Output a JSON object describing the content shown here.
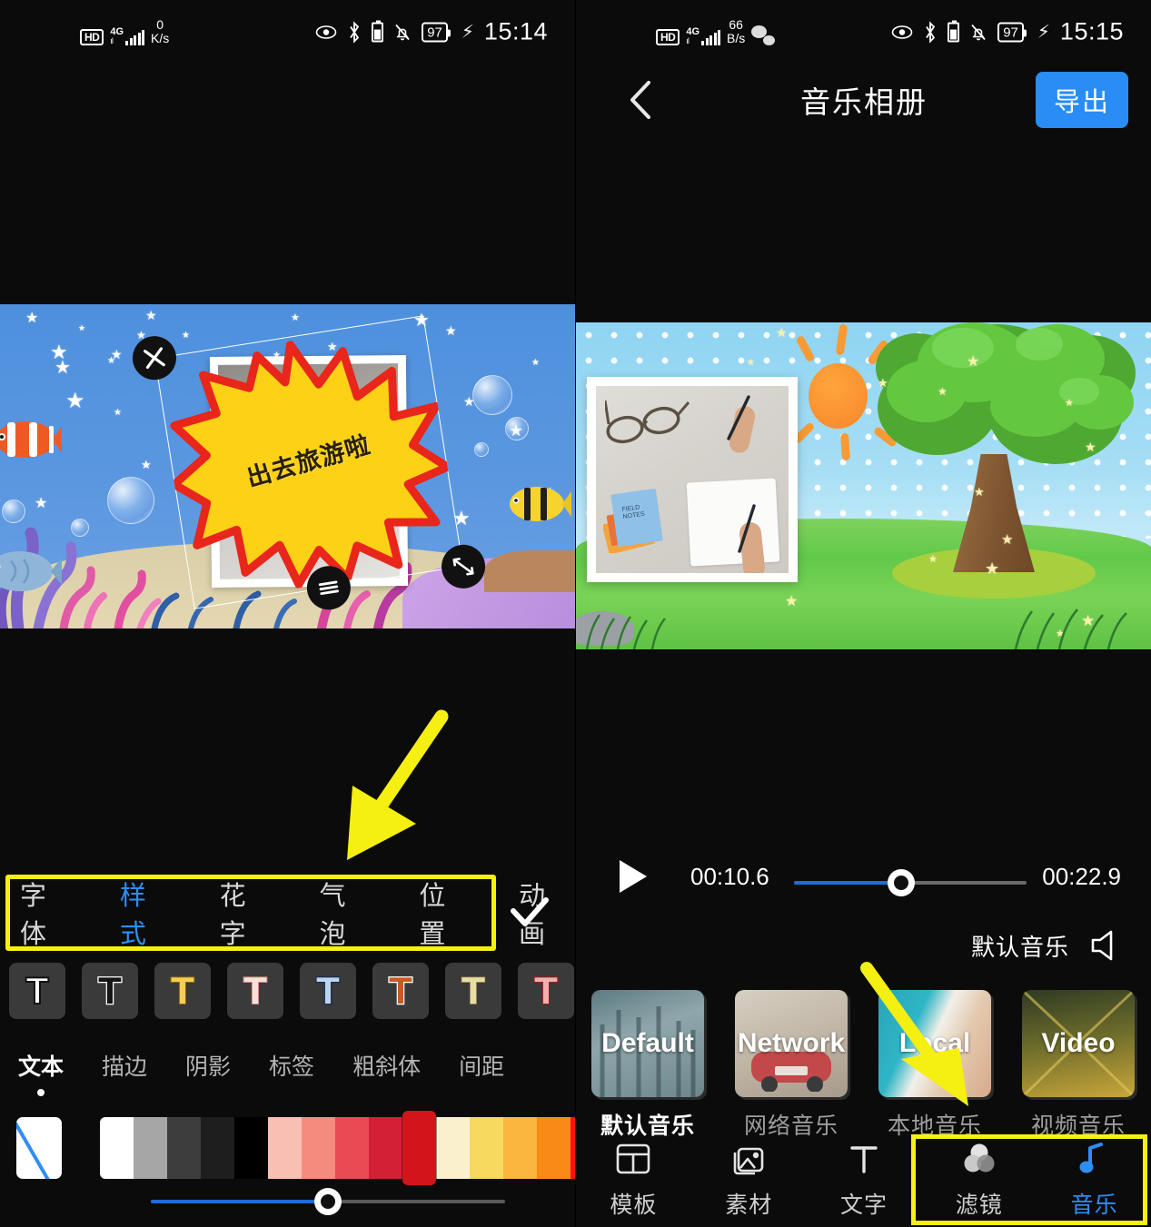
{
  "left_screen": {
    "statusbar": {
      "hd": "HD",
      "network": "4G",
      "netspeed_value": "0",
      "netspeed_unit": "K/s",
      "battery_percent": "97",
      "time": "15:14",
      "icons": [
        "eye-icon",
        "bluetooth-icon",
        "bell-muted-icon",
        "battery-icon",
        "charging-bolt-icon"
      ]
    },
    "preview": {
      "sticker_text": "出去旅游啦",
      "handles": [
        "close-handle",
        "resize-handle",
        "menu-handle"
      ]
    },
    "tabs": [
      {
        "label": "字体",
        "active": false
      },
      {
        "label": "样式",
        "active": true
      },
      {
        "label": "花字",
        "active": false
      },
      {
        "label": "气泡",
        "active": false
      },
      {
        "label": "位置",
        "active": false
      },
      {
        "label": "动画",
        "active": false
      }
    ],
    "confirm_icon": "check-icon",
    "presets": [
      {
        "name": "preset-white-plain",
        "fill": "#ffffff",
        "stroke": "#101010"
      },
      {
        "name": "preset-black-white-outline",
        "fill": "#141414",
        "stroke": "#ffffff"
      },
      {
        "name": "preset-yellow",
        "fill": "#f4cf56",
        "stroke": "#8a6a14"
      },
      {
        "name": "preset-pink-glow",
        "fill": "#f0ded9",
        "stroke": "#d98b79"
      },
      {
        "name": "preset-blue",
        "fill": "#bcd6f2",
        "stroke": "#1b2c4a"
      },
      {
        "name": "preset-orange-outline",
        "fill": "#c85a22",
        "stroke": "#ffffff"
      },
      {
        "name": "preset-cream",
        "fill": "#e8dda6",
        "stroke": "#b09f5e"
      },
      {
        "name": "preset-salmon-red",
        "fill": "#eeb1ac",
        "stroke": "#8d1f20"
      }
    ],
    "subtabs": [
      {
        "label": "文本",
        "active": true
      },
      {
        "label": "描边",
        "active": false
      },
      {
        "label": "阴影",
        "active": false
      },
      {
        "label": "标签",
        "active": false
      },
      {
        "label": "粗斜体",
        "active": false
      },
      {
        "label": "间距",
        "active": false
      }
    ],
    "colors": {
      "none_swatch": "none-color-swatch",
      "palette": [
        {
          "hex": "#ffffff",
          "selected": false
        },
        {
          "hex": "#a6a6a6",
          "selected": false
        },
        {
          "hex": "#3d3d3d",
          "selected": false
        },
        {
          "hex": "#1e1e1e",
          "selected": false
        },
        {
          "hex": "#000000",
          "selected": false
        },
        {
          "hex": "#f9bfb2",
          "selected": false
        },
        {
          "hex": "#f58a7f",
          "selected": false
        },
        {
          "hex": "#ea4a52",
          "selected": false
        },
        {
          "hex": "#d32036",
          "selected": false
        },
        {
          "hex": "#d2151b",
          "selected": true
        },
        {
          "hex": "#fbf0cd",
          "selected": false
        },
        {
          "hex": "#f6d95e",
          "selected": false
        },
        {
          "hex": "#fab63f",
          "selected": false
        },
        {
          "hex": "#fa8a16",
          "selected": false
        },
        {
          "hex": "#f81414",
          "selected": false
        }
      ],
      "opacity_percent": 50
    },
    "annotation": {
      "arrow": "yellow-arrow-down-left",
      "highlight": "yellow-box-tabs"
    }
  },
  "right_screen": {
    "statusbar": {
      "hd": "HD",
      "network": "4G",
      "netspeed_value": "66",
      "netspeed_unit": "B/s",
      "battery_percent": "97",
      "time": "15:15",
      "icons": [
        "wechat-icon",
        "eye-icon",
        "bluetooth-icon",
        "bell-muted-icon",
        "battery-icon",
        "charging-bolt-icon"
      ]
    },
    "header": {
      "back_icon": "back-chevron-icon",
      "title": "音乐相册",
      "export_label": "导出"
    },
    "player": {
      "play_icon": "play-icon",
      "current_time": "00:10.6",
      "total_time": "00:22.9",
      "progress_percent": 46
    },
    "music_label": {
      "text": "默认音乐",
      "icon": "speaker-icon"
    },
    "music_cards": [
      {
        "thumb_label": "Default",
        "caption": "默认音乐",
        "active": true
      },
      {
        "thumb_label": "Network",
        "caption": "网络音乐",
        "active": false
      },
      {
        "thumb_label": "Local",
        "caption": "本地音乐",
        "active": false
      },
      {
        "thumb_label": "Video",
        "caption": "视频音乐",
        "active": false
      }
    ],
    "bottom_nav": [
      {
        "label": "模板",
        "icon": "template-icon",
        "active": false
      },
      {
        "label": "素材",
        "icon": "media-icon",
        "active": false
      },
      {
        "label": "文字",
        "icon": "text-icon",
        "active": false
      },
      {
        "label": "滤镜",
        "icon": "filter-icon",
        "active": false
      },
      {
        "label": "音乐",
        "icon": "music-note-icon",
        "active": true
      }
    ],
    "annotation": {
      "arrow": "yellow-arrow-down-right",
      "highlight": "yellow-box-nav"
    }
  },
  "accent": {
    "blue": "#2f8ef4",
    "yellow": "#f7f112",
    "red": "#d2151b"
  }
}
